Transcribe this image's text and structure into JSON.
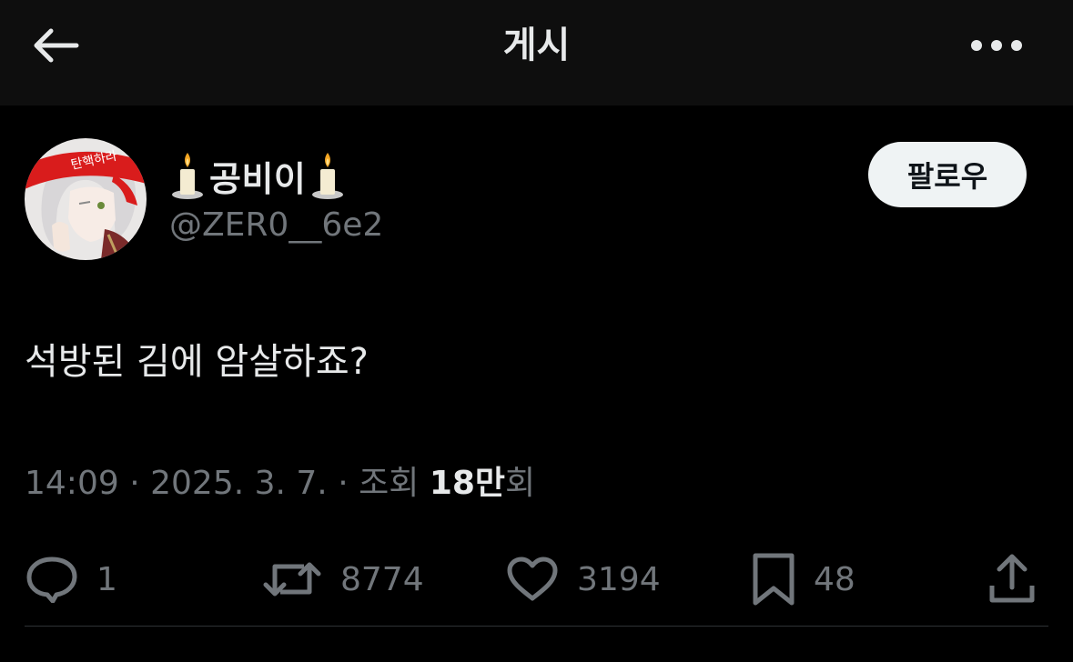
{
  "header": {
    "title": "게시"
  },
  "author": {
    "display_name": "공비이",
    "handle": "@ZER0__6e2",
    "avatar_headband_text": "탄핵하라"
  },
  "follow_label": "팔로우",
  "post": {
    "text": "석방된 김에 암살하죠?"
  },
  "meta": {
    "time": "14:09",
    "date": "2025. 3. 7.",
    "views_prefix": "조회",
    "views_value": "18만",
    "views_suffix": "회",
    "separator": "·"
  },
  "actions": {
    "replies": "1",
    "reposts": "8774",
    "likes": "3194",
    "bookmarks": "48"
  },
  "icons": {
    "back": "arrow-left-icon",
    "more": "more-horizontal-icon",
    "reply": "reply-icon",
    "repost": "repost-icon",
    "like": "heart-icon",
    "bookmark": "bookmark-icon",
    "share": "share-icon",
    "candle": "candle-icon"
  },
  "colors": {
    "background": "#000000",
    "header_background": "#0e0e0e",
    "text_primary": "#e7e9ea",
    "text_secondary": "#71767b",
    "follow_button_bg": "#eff3f4",
    "divider": "#2f3336"
  }
}
